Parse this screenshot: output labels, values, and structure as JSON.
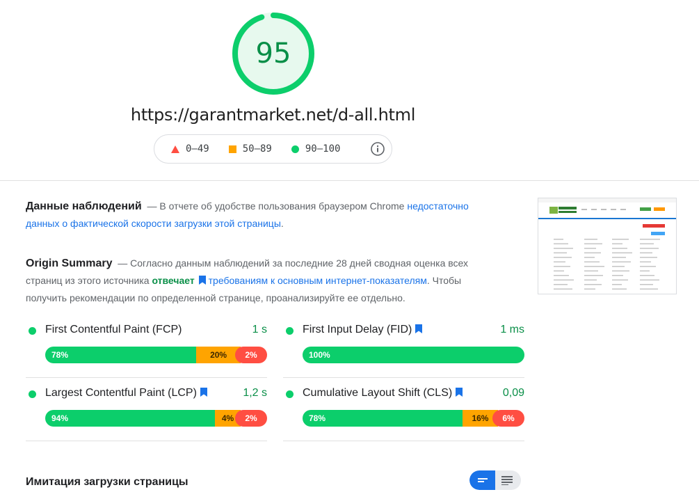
{
  "score": {
    "value": "95",
    "fraction": 0.95,
    "color": "#0cce6b"
  },
  "url": "https://garantmarket.net/d-all.html",
  "legend": {
    "poor": "0–49",
    "average": "50–89",
    "good": "90–100",
    "info_icon": "info-icon"
  },
  "field_data": {
    "title": "Данные наблюдений",
    "text_before": "— В отчете об удобстве пользования браузером Chrome ",
    "link": "недостаточно данных о фактической скорости загрузки этой страницы",
    "text_after": "."
  },
  "origin_summary": {
    "title": "Origin Summary",
    "text_before": "— Согласно данным наблюдений за последние 28 дней сводная оценка всех страниц из этого источника ",
    "status": "отвечает",
    "link": "требованиям к основным интернет-показателям",
    "text_after": ". Чтобы получить рекомендации по определенной странице, проанализируйте ее отдельно."
  },
  "metrics": [
    {
      "name": "First Contentful Paint (FCP)",
      "value": "1 s",
      "bookmark": false,
      "good": "78%",
      "average": "20%",
      "poor": "2%",
      "good_frac": 0.78,
      "average_frac": 0.2,
      "poor_frac": 0.02
    },
    {
      "name": "First Input Delay (FID)",
      "value": "1 ms",
      "bookmark": true,
      "good": "100%",
      "average": "",
      "poor": "",
      "good_frac": 1.0,
      "average_frac": 0,
      "poor_frac": 0
    },
    {
      "name": "Largest Contentful Paint (LCP)",
      "value": "1,2 s",
      "bookmark": true,
      "good": "94%",
      "average": "4%",
      "poor": "2%",
      "good_frac": 0.94,
      "average_frac": 0.04,
      "poor_frac": 0.02
    },
    {
      "name": "Cumulative Layout Shift (CLS)",
      "value": "0,09",
      "bookmark": true,
      "good": "78%",
      "average": "16%",
      "poor": "6%",
      "good_frac": 0.78,
      "average_frac": 0.16,
      "poor_frac": 0.06
    }
  ],
  "lab_data": {
    "title": "Имитация загрузки страницы"
  },
  "colors": {
    "good": "#0cce6b",
    "average": "#ffa400",
    "poor": "#ff4e42",
    "link": "#1a73e8",
    "pass_text": "#0a8f48"
  }
}
